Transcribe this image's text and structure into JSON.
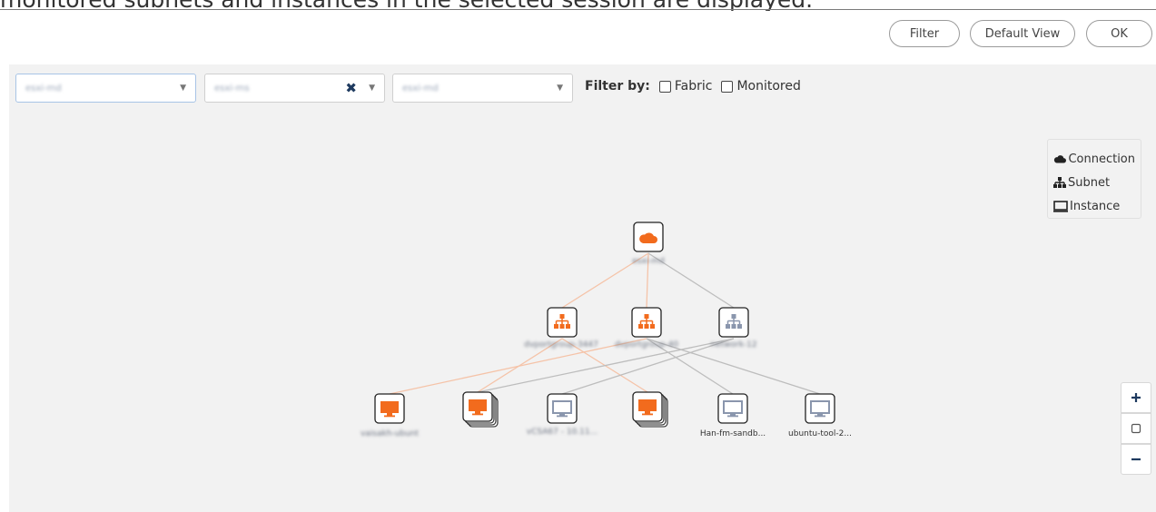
{
  "caption": "monitored subnets and instances in the selected session are displayed.",
  "toolbar": {
    "filter_label": "Filter",
    "default_view_label": "Default View",
    "ok_label": "OK"
  },
  "selectors": [
    {
      "value": "esxi-md",
      "has_clear": false
    },
    {
      "value": "esxi-ms",
      "has_clear": true
    },
    {
      "value": "esxi-md",
      "has_clear": false
    }
  ],
  "filter_by": {
    "label": "Filter by:",
    "options": [
      {
        "label": "Fabric",
        "checked": false
      },
      {
        "label": "Monitored",
        "checked": false
      }
    ]
  },
  "legend": {
    "items": [
      {
        "icon": "cloud-icon",
        "label": "Connection"
      },
      {
        "icon": "subnet-icon",
        "label": "Subnet"
      },
      {
        "icon": "monitor-icon",
        "label": "Instance"
      }
    ]
  },
  "colors": {
    "monitored": "#f26b1d",
    "unmonitored": "#8a96ad",
    "edge_orange": "#f5c3a8",
    "edge_gray": "#bdbdbd"
  },
  "topology": {
    "nodes": [
      {
        "id": "conn",
        "type": "connection",
        "monitored": true,
        "label": "esxi-md",
        "blurred": true
      },
      {
        "id": "s1",
        "type": "subnet",
        "monitored": true,
        "label": "dvportgroup-3447",
        "blurred": true
      },
      {
        "id": "s2",
        "type": "subnet",
        "monitored": true,
        "label": "dvportgroup-40",
        "blurred": true
      },
      {
        "id": "s3",
        "type": "subnet",
        "monitored": false,
        "label": "network-12",
        "blurred": true
      },
      {
        "id": "i1",
        "type": "instance",
        "monitored": true,
        "stacked": false,
        "label": "vaisakh-ubunt",
        "blurred": true
      },
      {
        "id": "i2",
        "type": "instance",
        "monitored": true,
        "stacked": true,
        "label": "",
        "blurred": false
      },
      {
        "id": "i3",
        "type": "instance",
        "monitored": false,
        "stacked": false,
        "label": "vCSA67 - 10.11...",
        "blurred": true
      },
      {
        "id": "i4",
        "type": "instance",
        "monitored": true,
        "stacked": true,
        "label": "",
        "blurred": false
      },
      {
        "id": "i5",
        "type": "instance",
        "monitored": false,
        "stacked": false,
        "label": "Han-fm-sandb...",
        "blurred": false
      },
      {
        "id": "i6",
        "type": "instance",
        "monitored": false,
        "stacked": false,
        "label": "ubuntu-tool-2...",
        "blurred": false
      }
    ],
    "edges": [
      {
        "from": "conn",
        "to": "s1",
        "color": "orange"
      },
      {
        "from": "conn",
        "to": "s2",
        "color": "orange"
      },
      {
        "from": "conn",
        "to": "s3",
        "color": "gray"
      },
      {
        "from": "s2",
        "to": "i1",
        "color": "orange"
      },
      {
        "from": "s1",
        "to": "i2",
        "color": "orange"
      },
      {
        "from": "s1",
        "to": "i4",
        "color": "orange"
      },
      {
        "from": "s3",
        "to": "i3",
        "color": "gray"
      },
      {
        "from": "s2",
        "to": "i5",
        "color": "gray"
      },
      {
        "from": "s2",
        "to": "i6",
        "color": "gray"
      },
      {
        "from": "s3",
        "to": "i2",
        "color": "gray"
      }
    ]
  },
  "zoom": {
    "in_icon": "plus-icon",
    "reset_icon": "square-icon",
    "out_icon": "minus-icon"
  }
}
